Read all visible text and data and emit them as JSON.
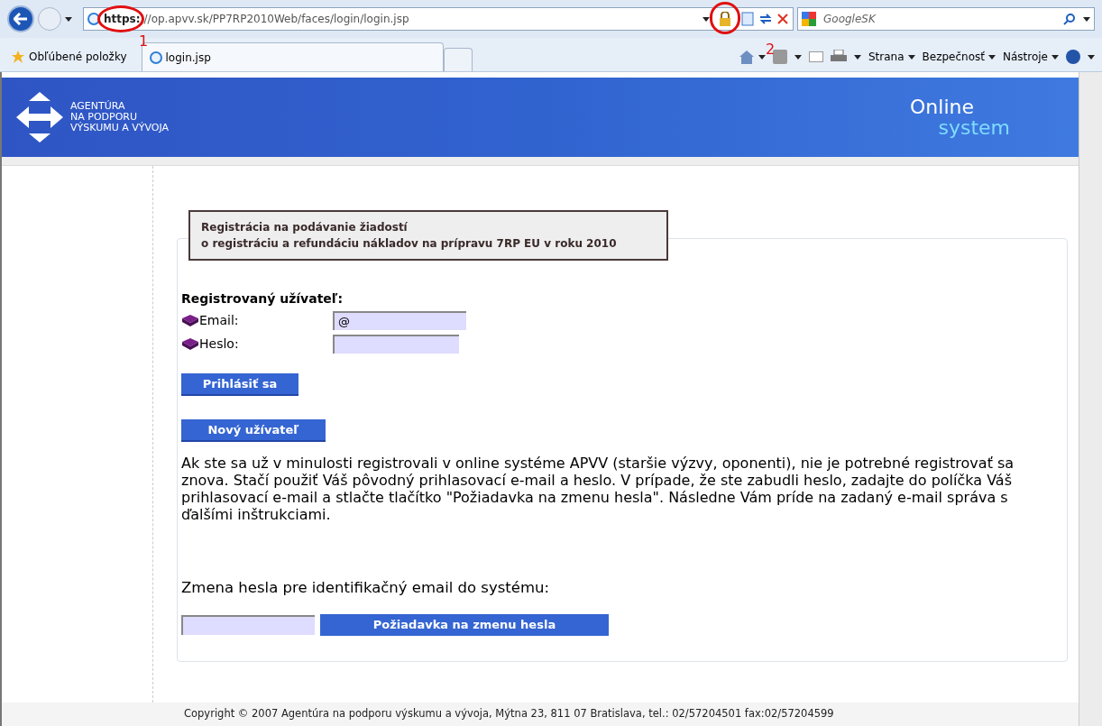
{
  "browser": {
    "url_scheme": "https:",
    "url_rest": "//op.apvv.sk/PP7RP2010Web/faces/login/login.jsp",
    "search_placeholder": "GoogleSK",
    "favorites": "Obľúbené položky",
    "tab": "login.jsp",
    "commands": [
      "Strana",
      "Bezpečnosť",
      "Nástroje"
    ]
  },
  "annotations": [
    {
      "label": "1"
    },
    {
      "label": "2"
    }
  ],
  "header": {
    "logo_lines": [
      "AGENTÚRA",
      "NA PODPORU",
      "VÝSKUMU A VÝVOJA"
    ],
    "title_top": "Online",
    "title_bottom": "system"
  },
  "notice": [
    "Registrácia na podávanie žiadostí",
    "o registráciu a refundáciu nákladov na prípravu 7RP EU v roku 2010"
  ],
  "login": {
    "heading": "Registrovaný užívateľ:",
    "fields": [
      {
        "label": "Email:",
        "value": "@"
      },
      {
        "label": "Heslo:"
      }
    ],
    "login_button": "Prihlásiť sa",
    "new_user_button": "Nový užívateľ"
  },
  "info": "Ak ste sa už v minulosti registrovali v online systéme APVV (staršie výzvy, oponenti), nie je potrebné registrovať sa znova. Stačí použiť Váš pôvodný prihlasovací e-mail a heslo. V prípade, že ste zabudli heslo, zadajte do políčka Váš prihlasovací e-mail a stlačte tlačítko \"Požiadavka na zmenu hesla\". Následne Vám príde na zadaný e-mail správa s ďalšími inštrukciami.",
  "reset": {
    "heading": "Zmena hesla pre identifikačný email do systému:",
    "button": "Požiadavka na zmenu hesla"
  },
  "footer": "Copyright © 2007 Agentúra na podporu výskumu a vývoja, Mýtna 23, 811 07 Bratislava, tel.: 02/57204501 fax:02/57204599"
}
